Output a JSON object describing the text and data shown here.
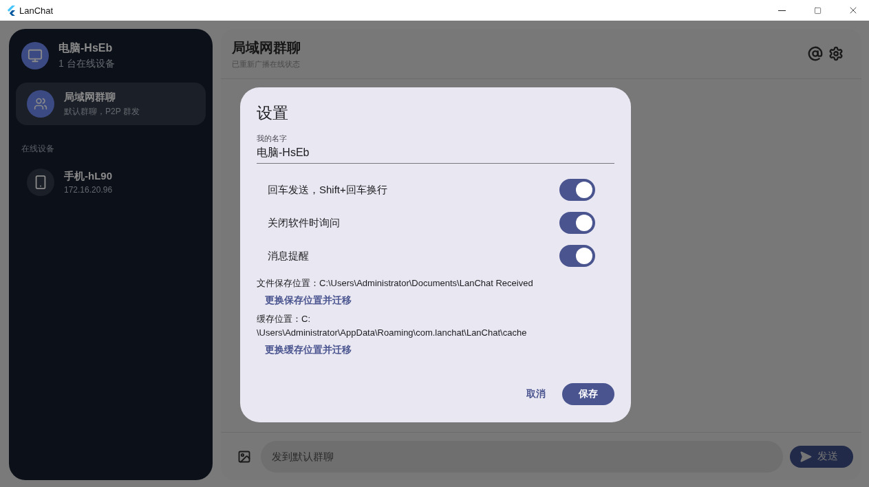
{
  "window": {
    "title": "LanChat"
  },
  "sidebar": {
    "profile": {
      "name": "电脑-HsEb",
      "status": "1 台在线设备"
    },
    "chats": [
      {
        "name": "局域网群聊",
        "subtitle": "默认群聊，P2P 群发",
        "selected": true,
        "kind": "group"
      }
    ],
    "section_label": "在线设备",
    "devices": [
      {
        "name": "手机-hL90",
        "address": "172.16.20.96",
        "kind": "phone"
      }
    ]
  },
  "chat": {
    "title": "局域网群聊",
    "subtitle": "已重新广播在线状态",
    "composer": {
      "placeholder": "发到默认群聊"
    },
    "send_button": "发送"
  },
  "dialog": {
    "title": "设置",
    "name_field": {
      "label": "我的名字",
      "value": "电脑-HsEb"
    },
    "toggles": [
      {
        "label": "回车发送，Shift+回车换行",
        "on": true
      },
      {
        "label": "关闭软件时询问",
        "on": true
      },
      {
        "label": "消息提醒",
        "on": true
      }
    ],
    "locations": [
      {
        "text": "文件保存位置：C:\\Users\\Administrator\\Documents\\LanChat Received",
        "action": "更换保存位置并迁移"
      },
      {
        "text": "缓存位置：C:\n\\Users\\Administrator\\AppData\\Roaming\\com.lanchat\\LanChat\\cache",
        "action": "更换缓存位置并迁移"
      }
    ],
    "buttons": {
      "cancel": "取消",
      "save": "保存"
    }
  }
}
